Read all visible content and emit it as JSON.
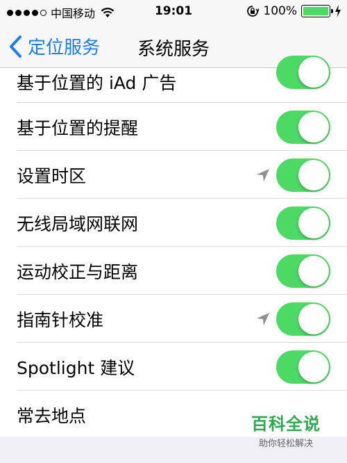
{
  "status": {
    "carrier": "中国移动",
    "time": "19:01",
    "battery": "100%",
    "battery_level": 1.0
  },
  "nav": {
    "back_label": "定位服务",
    "title": "系统服务"
  },
  "rows": [
    {
      "label": "基于位置的 iAd 广告",
      "toggle": true,
      "location_arrow": false
    },
    {
      "label": "基于位置的提醒",
      "toggle": true,
      "location_arrow": false
    },
    {
      "label": "设置时区",
      "toggle": true,
      "location_arrow": true
    },
    {
      "label": "无线局域网联网",
      "toggle": true,
      "location_arrow": false
    },
    {
      "label": "运动校正与距离",
      "toggle": true,
      "location_arrow": false
    },
    {
      "label": "指南针校准",
      "toggle": true,
      "location_arrow": true
    },
    {
      "label": "Spotlight 建议",
      "toggle": true,
      "location_arrow": false
    },
    {
      "label": "常去地点",
      "toggle": false,
      "location_arrow": false
    }
  ],
  "watermark": {
    "main": "百科全说",
    "sub": "助你轻松解决"
  },
  "colors": {
    "accent": "#1e7cf2",
    "toggle_on": "#4cd964",
    "watermark": "#2ea84e"
  }
}
